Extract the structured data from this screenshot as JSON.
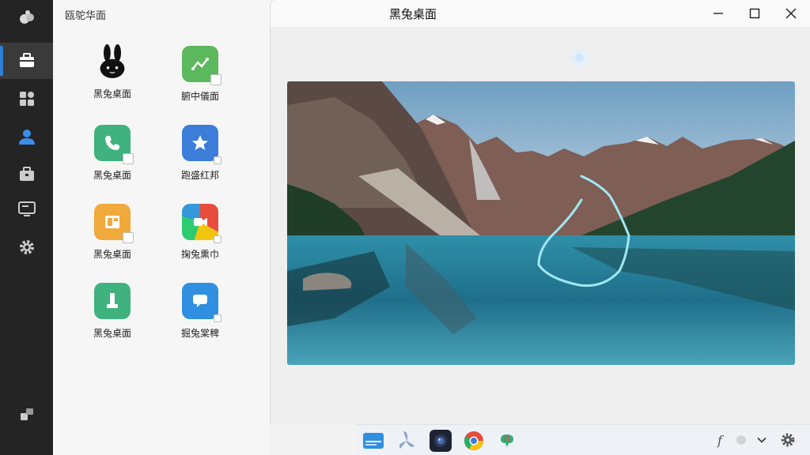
{
  "sidebar": {
    "items": [
      {
        "name": "logo-icon"
      },
      {
        "name": "toolbox-icon",
        "active": true
      },
      {
        "name": "apps-grid-icon"
      },
      {
        "name": "user-icon"
      },
      {
        "name": "briefcase-icon"
      },
      {
        "name": "monitor-icon"
      },
      {
        "name": "settings-icon"
      },
      {
        "name": "puzzle-icon"
      }
    ],
    "accent": "#2f7fd8"
  },
  "panel": {
    "title": "瓯鸵华面",
    "apps": [
      {
        "label": "黑兔桌面",
        "icon": "rabbit-icon",
        "color": "#111111"
      },
      {
        "label": "腑中儀面",
        "icon": "route-icon",
        "color": "#5cb85c"
      },
      {
        "label": "黑兔桌面",
        "icon": "phone-icon",
        "color": "#3fb27f"
      },
      {
        "label": "跑盛红邦",
        "icon": "star-icon",
        "color": "#3b7dd8"
      },
      {
        "label": "黑兔桌面",
        "icon": "layout-icon",
        "color": "#f0a93b"
      },
      {
        "label": "掬兔熏巾",
        "icon": "video-icon",
        "color": "#e74c3c"
      },
      {
        "label": "黑兔桌面",
        "icon": "usb-icon",
        "color": "#3fb27f"
      },
      {
        "label": "掘兔棠稗",
        "icon": "chat-icon",
        "color": "#2f8fe0"
      }
    ]
  },
  "window": {
    "title": "黑兔桌面",
    "minimize_icon": "minimize-icon",
    "maximize_icon": "maximize-icon",
    "close_icon": "close-icon"
  },
  "taskbar": {
    "apps": [
      "file-manager-icon",
      "fan-icon",
      "camera-icon",
      "chrome-icon",
      "brain-icon"
    ],
    "tray_text": "f",
    "tray": [
      "status-dot-icon",
      "chevron-down-icon",
      "gear-icon"
    ]
  }
}
